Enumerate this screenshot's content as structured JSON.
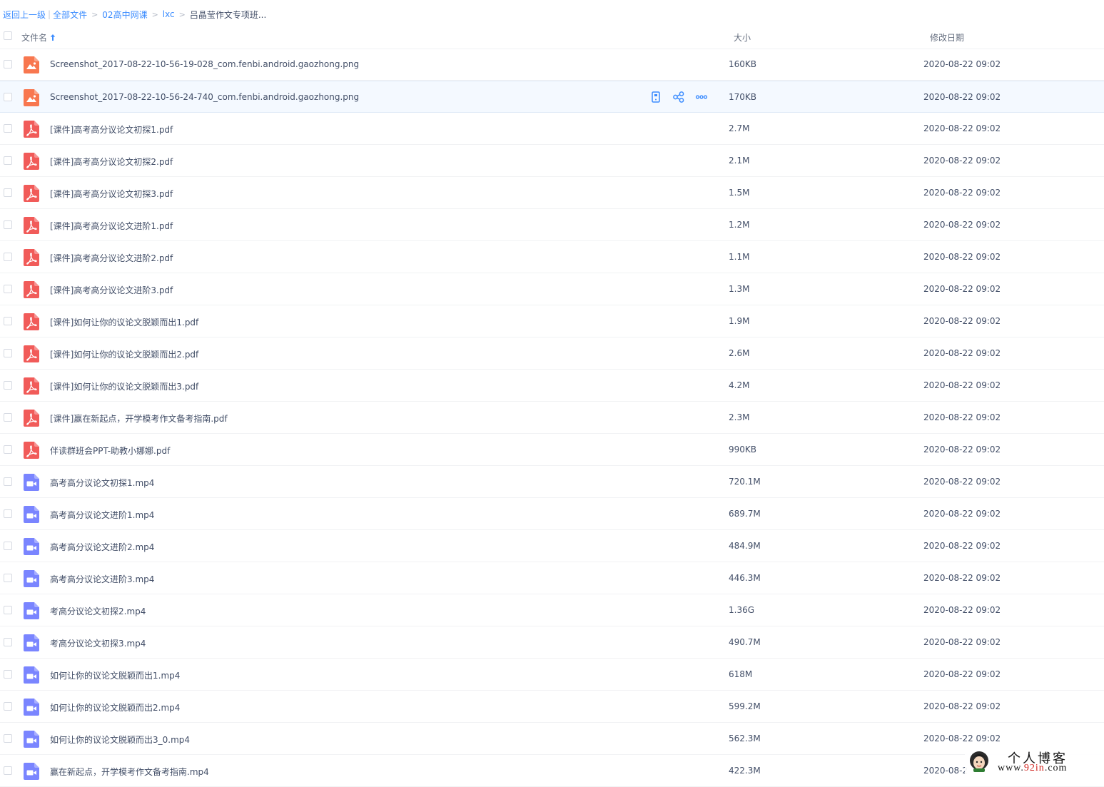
{
  "breadcrumb": {
    "back": "返回上一级",
    "all": "全部文件",
    "crumbs": [
      "02高中网课",
      "lxc"
    ],
    "current": "吕晶莹作文专项班..."
  },
  "header": {
    "name": "文件名",
    "size": "大小",
    "date": "修改日期"
  },
  "colors": {
    "image": "#f8774f",
    "pdf": "#f15b59",
    "video": "#7a85ff",
    "accent": "#3b8cff"
  },
  "files": [
    {
      "name": "Screenshot_2017-08-22-10-56-19-028_com.fenbi.android.gaozhong.png",
      "size": "160KB",
      "date": "2020-08-22 09:02",
      "type": "image"
    },
    {
      "name": "Screenshot_2017-08-22-10-56-24-740_com.fenbi.android.gaozhong.png",
      "size": "170KB",
      "date": "2020-08-22 09:02",
      "type": "image"
    },
    {
      "name": "[课件]高考高分议论文初探1.pdf",
      "size": "2.7M",
      "date": "2020-08-22 09:02",
      "type": "pdf"
    },
    {
      "name": "[课件]高考高分议论文初探2.pdf",
      "size": "2.1M",
      "date": "2020-08-22 09:02",
      "type": "pdf"
    },
    {
      "name": "[课件]高考高分议论文初探3.pdf",
      "size": "1.5M",
      "date": "2020-08-22 09:02",
      "type": "pdf"
    },
    {
      "name": "[课件]高考高分议论文进阶1.pdf",
      "size": "1.2M",
      "date": "2020-08-22 09:02",
      "type": "pdf"
    },
    {
      "name": "[课件]高考高分议论文进阶2.pdf",
      "size": "1.1M",
      "date": "2020-08-22 09:02",
      "type": "pdf"
    },
    {
      "name": "[课件]高考高分议论文进阶3.pdf",
      "size": "1.3M",
      "date": "2020-08-22 09:02",
      "type": "pdf"
    },
    {
      "name": "[课件]如何让你的议论文脱颖而出1.pdf",
      "size": "1.9M",
      "date": "2020-08-22 09:02",
      "type": "pdf"
    },
    {
      "name": "[课件]如何让你的议论文脱颖而出2.pdf",
      "size": "2.6M",
      "date": "2020-08-22 09:02",
      "type": "pdf"
    },
    {
      "name": "[课件]如何让你的议论文脱颖而出3.pdf",
      "size": "4.2M",
      "date": "2020-08-22 09:02",
      "type": "pdf"
    },
    {
      "name": "[课件]赢在新起点，开学模考作文备考指南.pdf",
      "size": "2.3M",
      "date": "2020-08-22 09:02",
      "type": "pdf"
    },
    {
      "name": "伴读群班会PPT-助教小娜娜.pdf",
      "size": "990KB",
      "date": "2020-08-22 09:02",
      "type": "pdf"
    },
    {
      "name": "高考高分议论文初探1.mp4",
      "size": "720.1M",
      "date": "2020-08-22 09:02",
      "type": "video"
    },
    {
      "name": "高考高分议论文进阶1.mp4",
      "size": "689.7M",
      "date": "2020-08-22 09:02",
      "type": "video"
    },
    {
      "name": "高考高分议论文进阶2.mp4",
      "size": "484.9M",
      "date": "2020-08-22 09:02",
      "type": "video"
    },
    {
      "name": "高考高分议论文进阶3.mp4",
      "size": "446.3M",
      "date": "2020-08-22 09:02",
      "type": "video"
    },
    {
      "name": "考高分议论文初探2.mp4",
      "size": "1.36G",
      "date": "2020-08-22 09:02",
      "type": "video"
    },
    {
      "name": "考高分议论文初探3.mp4",
      "size": "490.7M",
      "date": "2020-08-22 09:02",
      "type": "video"
    },
    {
      "name": "如何让你的议论文脱颖而出1.mp4",
      "size": "618M",
      "date": "2020-08-22 09:02",
      "type": "video"
    },
    {
      "name": "如何让你的议论文脱颖而出2.mp4",
      "size": "599.2M",
      "date": "2020-08-22 09:02",
      "type": "video"
    },
    {
      "name": "如何让你的议论文脱颖而出3_0.mp4",
      "size": "562.3M",
      "date": "2020-08-22 09:02",
      "type": "video"
    },
    {
      "name": "赢在新起点，开学模考作文备考指南.mp4",
      "size": "422.3M",
      "date": "2020-08-2",
      "type": "video"
    }
  ],
  "hover_row": 1,
  "watermark": {
    "title": "个人博客",
    "url_prefix": "www.",
    "url_highlight": "92in",
    "url_suffix": ".com"
  }
}
